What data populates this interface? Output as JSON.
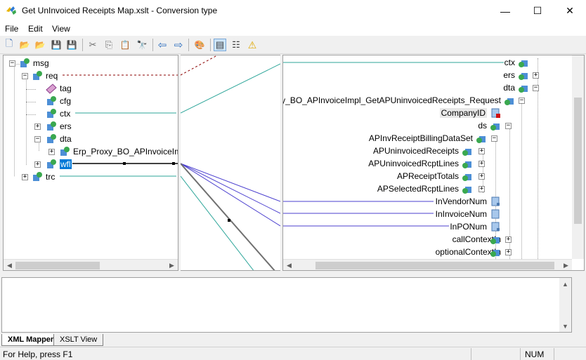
{
  "window": {
    "title": "Get UnInvoiced Receipts Map.xslt - Conversion type",
    "minimize_glyph": "—",
    "maximize_glyph": "☐",
    "close_glyph": "✕"
  },
  "menu": {
    "items": [
      "File",
      "Edit",
      "View"
    ]
  },
  "toolbar": {
    "buttons": [
      {
        "icon": "new-file-icon",
        "glyph": "🗋"
      },
      {
        "icon": "open-folder-icon",
        "glyph": "📂"
      },
      {
        "icon": "open-folder-2-icon",
        "glyph": "📂"
      },
      {
        "icon": "save-icon",
        "glyph": "💾"
      },
      {
        "icon": "save-all-icon",
        "glyph": "💾"
      },
      {
        "icon": "cut-icon",
        "glyph": "✂"
      },
      {
        "icon": "copy-icon",
        "glyph": "⎘"
      },
      {
        "icon": "paste-icon",
        "glyph": "📋"
      },
      {
        "icon": "find-icon",
        "glyph": "🔭"
      },
      {
        "icon": "back-icon",
        "glyph": "⇦"
      },
      {
        "icon": "forward-icon",
        "glyph": "⇨"
      },
      {
        "icon": "palette-icon",
        "glyph": "🎨"
      },
      {
        "icon": "mapper-view-icon",
        "glyph": "▤"
      },
      {
        "icon": "list-view-icon",
        "glyph": "☷"
      },
      {
        "icon": "warning-icon",
        "glyph": "⚠"
      }
    ]
  },
  "source_tree": {
    "nodes": [
      {
        "label": "msg",
        "name": "source-node-msg"
      },
      {
        "label": "req",
        "name": "source-node-req"
      },
      {
        "label": "tag",
        "name": "source-node-tag"
      },
      {
        "label": "cfg",
        "name": "source-node-cfg"
      },
      {
        "label": "ctx",
        "name": "source-node-ctx"
      },
      {
        "label": "ers",
        "name": "source-node-ers"
      },
      {
        "label": "dta",
        "name": "source-node-dta"
      },
      {
        "label": "Erp_Proxy_BO_APInvoiceIm",
        "name": "source-node-erp-proxy"
      },
      {
        "label": "wfl",
        "name": "source-node-wfl"
      },
      {
        "label": "trc",
        "name": "source-node-trc"
      }
    ]
  },
  "target_tree": {
    "nodes": [
      {
        "label": "ctx",
        "name": "target-node-ctx"
      },
      {
        "label": "ers",
        "name": "target-node-ers"
      },
      {
        "label": "dta",
        "name": "target-node-dta"
      },
      {
        "label": "oxy_BO_APInvoiceImpl_GetAPUninvoicedReceipts_Request",
        "name": "target-node-request"
      },
      {
        "label": "CompanyID",
        "name": "target-node-companyid"
      },
      {
        "label": "ds",
        "name": "target-node-ds"
      },
      {
        "label": "APInvReceiptBillingDataSet",
        "name": "target-node-dataset"
      },
      {
        "label": "APUninvoicedReceipts",
        "name": "target-node-uninvoiced-receipts"
      },
      {
        "label": "APUninvoicedRcptLines",
        "name": "target-node-uninvoiced-rcpt-lines"
      },
      {
        "label": "APReceiptTotals",
        "name": "target-node-receipt-totals"
      },
      {
        "label": "APSelectedRcptLines",
        "name": "target-node-selected-rcpt-lines"
      },
      {
        "label": "InVendorNum",
        "name": "target-node-invendornum"
      },
      {
        "label": "InInvoiceNum",
        "name": "target-node-ininvoicenum"
      },
      {
        "label": "InPONum",
        "name": "target-node-inponum"
      },
      {
        "label": "callContextIn",
        "name": "target-node-callcontextin"
      },
      {
        "label": "optionalContextIn",
        "name": "target-node-optionalcontextin"
      }
    ]
  },
  "tabs": [
    {
      "label": "XML Mapper",
      "active": true
    },
    {
      "label": "XSLT View",
      "active": false
    }
  ],
  "status": {
    "help_text": "For Help, press F1",
    "num": "NUM"
  },
  "colors": {
    "link_teal": "#2ea69a",
    "link_purple": "#4b3fcf",
    "link_dashed": "#8b0000",
    "selection": "#0078d7"
  }
}
